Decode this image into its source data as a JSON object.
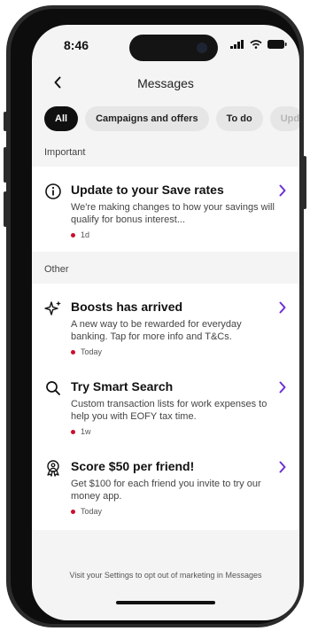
{
  "status": {
    "time": "8:46"
  },
  "header": {
    "title": "Messages"
  },
  "chips": [
    {
      "label": "All"
    },
    {
      "label": "Campaigns and offers"
    },
    {
      "label": "To do"
    },
    {
      "label": "Upd"
    }
  ],
  "sections": {
    "important": "Important",
    "other": "Other"
  },
  "messages": [
    {
      "title": "Update to your Save rates",
      "body": "We're making changes to how your savings will qualify for bonus interest...",
      "time": "1d",
      "icon": "info-icon"
    },
    {
      "title": "Boosts has arrived",
      "body": "A new way to be rewarded for everyday banking. Tap for more info and T&Cs.",
      "time": "Today",
      "icon": "sparkle-icon"
    },
    {
      "title": "Try Smart Search",
      "body": "Custom transaction lists for work expenses to help you with EOFY tax time.",
      "time": "1w",
      "icon": "search-icon"
    },
    {
      "title": "Score $50 per friend!",
      "body": "Get $100 for each friend you invite to try our money app.",
      "time": "Today",
      "icon": "referral-icon"
    }
  ],
  "footer": {
    "text": "Visit your Settings to opt out of marketing in Messages"
  },
  "colors": {
    "accent": "#6b2fd1",
    "unread_dot": "#c8102e",
    "chip_active": "#101010"
  }
}
